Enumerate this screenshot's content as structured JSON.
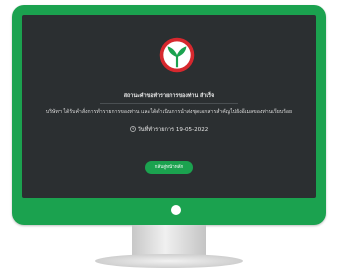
{
  "success_title": "สถานะคำขอทำรายการของท่าน สำเร็จ",
  "message": "บริษัทฯ ได้รับคำสั่งการทำรายการของท่าน และได้ดำเนินการนำส่งชุดเอกสารสำคัญไปยังอีเมลของท่านเรียบร้อย",
  "date_text": "วันที่ทำรายการ 19-05-2022",
  "home_button_label": "กลับสู่หน้าหลัก",
  "colors": {
    "brand_green": "#1ba24f",
    "screen_bg": "#2b2f31",
    "logo_red": "#d7282e"
  },
  "icons": [
    "bank-logo-icon",
    "clock-icon",
    "power-indicator-icon"
  ]
}
